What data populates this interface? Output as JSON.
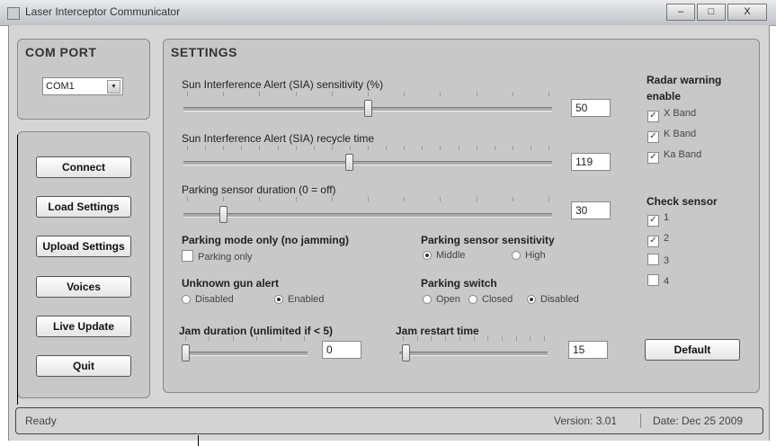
{
  "window": {
    "title": "Laser Interceptor Communicator",
    "minimize": "–",
    "maximize": "□",
    "close": "X"
  },
  "comport": {
    "heading": "COM PORT",
    "selected": "COM1"
  },
  "actions": {
    "connect": "Connect",
    "load": "Load Settings",
    "upload": "Upload Settings",
    "voices": "Voices",
    "live": "Live Update",
    "quit": "Quit"
  },
  "settings": {
    "heading": "SETTINGS",
    "sia_sensitivity": {
      "label": "Sun Interference Alert (SIA) sensitivity (%)",
      "value": "50",
      "level": 0.5
    },
    "sia_recycle": {
      "label": "Sun Interference Alert (SIA) recycle time",
      "value": "119",
      "level": 0.45
    },
    "parking_duration": {
      "label": "Parking sensor duration  (0 = off)",
      "value": "30",
      "level": 0.1
    },
    "parking_mode": {
      "label": "Parking mode only (no jamming)",
      "option": "Parking only",
      "checked": false
    },
    "parking_sensitivity": {
      "label": "Parking sensor sensitivity",
      "options": [
        "Middle",
        "High"
      ],
      "selected": "Middle"
    },
    "unknown_gun": {
      "label": "Unknown gun alert",
      "options": [
        "Disabled",
        "Enabled"
      ],
      "selected": "Enabled"
    },
    "parking_switch": {
      "label": "Parking switch",
      "options": [
        "Open",
        "Closed",
        "Disabled"
      ],
      "selected": "Disabled"
    },
    "jam_duration": {
      "label": "Jam duration  (unlimited if < 5)",
      "value": "0",
      "level": 0.0
    },
    "jam_restart": {
      "label": "Jam restart time",
      "value": "15",
      "level": 0.02
    },
    "radar": {
      "label_line1": "Radar warning",
      "label_line2": "enable",
      "bands": [
        "X Band",
        "K Band",
        "Ka Band"
      ],
      "checked": [
        true,
        true,
        true
      ]
    },
    "check_sensor": {
      "label": "Check sensor",
      "items": [
        "1",
        "2",
        "3",
        "4"
      ],
      "checked": [
        true,
        true,
        false,
        false
      ]
    },
    "default_button": "Default"
  },
  "status": {
    "text": "Ready",
    "version": "Version: 3.01",
    "date": "Date: Dec 25 2009"
  },
  "glyphs": {
    "check": "✓",
    "arrow": "▼"
  }
}
